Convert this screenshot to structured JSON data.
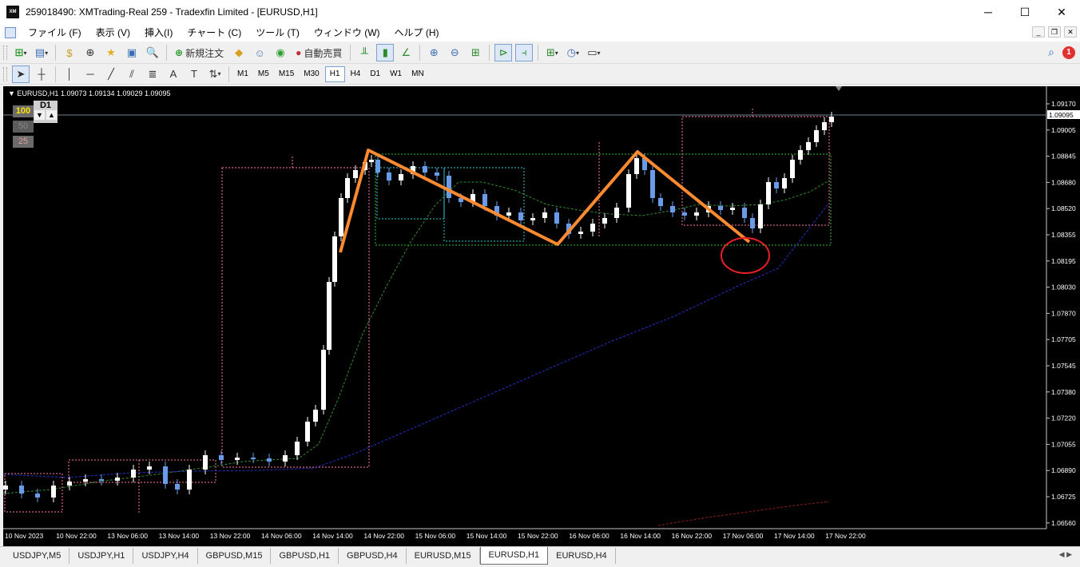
{
  "window": {
    "title": "259018490: XMTrading-Real 259 - Tradexfin Limited - [EURUSD,H1]",
    "app_icon_text": "XM",
    "minimize": "─",
    "maximize": "☐",
    "close": "✕"
  },
  "menu": {
    "items": [
      "ファイル (F)",
      "表示 (V)",
      "挿入(I)",
      "チャート (C)",
      "ツール (T)",
      "ウィンドウ (W)",
      "ヘルプ (H)"
    ]
  },
  "toolbar": {
    "new_order": "新規注文",
    "auto_trading": "自動売買",
    "timeframes": [
      "M1",
      "M5",
      "M15",
      "M30",
      "H1",
      "H4",
      "D1",
      "W1",
      "MN"
    ],
    "active_timeframe": "H1",
    "notification_count": "1"
  },
  "chart": {
    "info": "EURUSD,H1  1.09073 1.09134 1.09029 1.09095",
    "timeframe_label": "D1",
    "lot_buttons": [
      "100",
      "50",
      "25"
    ],
    "price_labels": [
      "1.09170",
      "1.09005",
      "1.08845",
      "1.08680",
      "1.08520",
      "1.08355",
      "1.08195",
      "1.08030",
      "1.07870",
      "1.07705",
      "1.07545",
      "1.07380",
      "1.07220",
      "1.07055",
      "1.06890",
      "1.06725",
      "1.06560"
    ],
    "current_price": "1.09095",
    "time_labels": [
      "10 Nov 2023",
      "10 Nov 22:00",
      "13 Nov 06:00",
      "13 Nov 14:00",
      "13 Nov 22:00",
      "14 Nov 06:00",
      "14 Nov 14:00",
      "14 Nov 22:00",
      "15 Nov 06:00",
      "15 Nov 14:00",
      "15 Nov 22:00",
      "16 Nov 06:00",
      "16 Nov 14:00",
      "16 Nov 22:00",
      "17 Nov 06:00",
      "17 Nov 14:00",
      "17 Nov 22:00"
    ]
  },
  "tabs": {
    "items": [
      "USDJPY,M5",
      "USDJPY,H1",
      "USDJPY,H4",
      "GBPUSD,M15",
      "GBPUSD,H1",
      "GBPUSD,H4",
      "EURUSD,M15",
      "EURUSD,H1",
      "EURUSD,H4"
    ],
    "active": "EURUSD,H1",
    "arrows": "◀ ▶"
  },
  "colors": {
    "chart_bg": "#000000",
    "bull_candle": "#ffffff",
    "bear_candle": "#6a9be8",
    "zigzag": "#ff8a30",
    "circle": "#e8202a",
    "ma_green": "#2e8b2e",
    "ma_blue": "#2530c8",
    "box_pink": "#ff7aa0",
    "box_cyan": "#30c8d8",
    "box_green": "#30c030"
  }
}
